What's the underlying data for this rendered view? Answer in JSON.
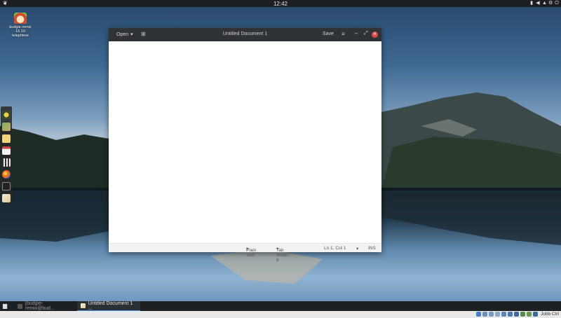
{
  "top_panel": {
    "clock": "12:42",
    "logo_icon": "budgie-logo-icon",
    "tray_icons": [
      "battery-icon",
      "volume-icon",
      "notification-icon",
      "settings-icon",
      "power-icon"
    ]
  },
  "desktop": {
    "icon_label": "budgie remix 16.10 telepítése"
  },
  "dock": {
    "items": [
      "budgie-welcome-icon",
      "photos-icon",
      "notes-icon",
      "calendar-icon",
      "video-icon",
      "firefox-icon",
      "terminal-icon",
      "text-editor-icon"
    ]
  },
  "window": {
    "open_label": "Open",
    "title": "Untitled Document 1",
    "save_label": "Save",
    "menu_glyph": "≡",
    "minimize_glyph": "–",
    "maximize_glyph": "⤢",
    "close_glyph": "✕",
    "status": {
      "language": "Plain Text",
      "tab_width": "Tab Width: 8",
      "position": "Ln 1, Col 1",
      "mode": "INS"
    }
  },
  "taskbar": {
    "tasks": [
      {
        "label": "[budgie-remix@bud..."
      },
      {
        "label": "Untitled Document 1 ..."
      }
    ]
  },
  "host_tray": {
    "label": "Jobb Ctrl"
  },
  "colors": {
    "panel": "#1c1f22",
    "titlebar": "#2f3336",
    "close": "#e04a48",
    "accent": "#5294e2"
  }
}
